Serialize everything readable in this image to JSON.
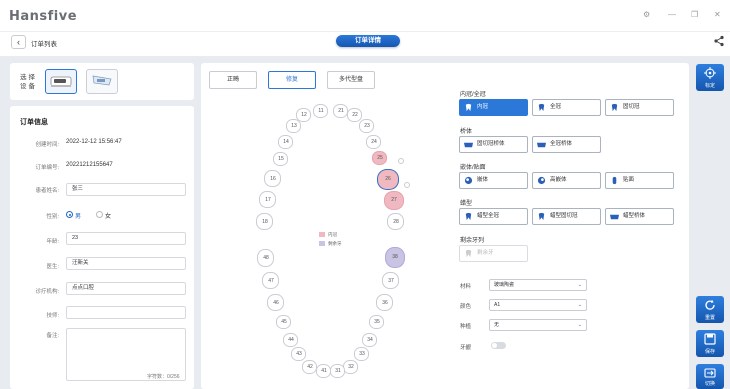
{
  "app": {
    "logo": "Hansfive"
  },
  "window": {
    "icons": [
      "settings-icon",
      "minimize-icon",
      "restore-icon",
      "close-icon"
    ]
  },
  "nav": {
    "back_label": "订单列表",
    "page_title": "订单详情"
  },
  "device": {
    "label": "选择设备"
  },
  "order": {
    "title": "订单信息",
    "created_label": "创建时间:",
    "created_value": "2022-12-12 15:56:47",
    "number_label": "订单编号:",
    "number_value": "20221212155647",
    "patient_label": "患者姓名:",
    "patient_value": "张三",
    "gender_label": "性别:",
    "male": "男",
    "female": "女",
    "age_label": "年龄:",
    "age_value": "23",
    "doctor_label": "医生:",
    "doctor_value": "汪新关",
    "clinic_label": "诊疗机构:",
    "clinic_value": "点点口腔",
    "tech_label": "技师:",
    "tech_value": "",
    "note_label": "备注:",
    "note_counter": "字符数：0/256"
  },
  "modes": {
    "normal": "正畸",
    "repair": "修复",
    "multi": "多代型盘"
  },
  "teeth": [
    {
      "n": "11"
    },
    {
      "n": "21"
    },
    {
      "n": "12"
    },
    {
      "n": "22"
    },
    {
      "n": "13"
    },
    {
      "n": "23"
    },
    {
      "n": "14"
    },
    {
      "n": "24"
    },
    {
      "n": "15"
    },
    {
      "n": "25"
    },
    {
      "n": "16"
    },
    {
      "n": "26"
    },
    {
      "n": "17"
    },
    {
      "n": "27"
    },
    {
      "n": "18"
    },
    {
      "n": "28"
    },
    {
      "n": "48"
    },
    {
      "n": "38"
    },
    {
      "n": "47"
    },
    {
      "n": "37"
    },
    {
      "n": "46"
    },
    {
      "n": "36"
    },
    {
      "n": "45"
    },
    {
      "n": "35"
    },
    {
      "n": "44"
    },
    {
      "n": "34"
    },
    {
      "n": "43"
    },
    {
      "n": "33"
    },
    {
      "n": "42"
    },
    {
      "n": "32"
    },
    {
      "n": "41"
    },
    {
      "n": "31"
    }
  ],
  "legend": {
    "crown": "内冠",
    "other": "剩余牙"
  },
  "colors": {
    "accent": "#2b78d8",
    "crown": "#f0b8c0",
    "remain": "#c9c3e4"
  },
  "restoration": {
    "crown_title": "内冠/全冠",
    "crown_items": [
      "内冠",
      "全冠",
      "固切冠"
    ],
    "bridge_title": "桥体",
    "bridge_items": [
      "固切冠桥体",
      "全冠桥体"
    ],
    "veneer_title": "嵌体/贴面",
    "veneer_items": [
      "嵌体",
      "高嵌体",
      "贴面"
    ],
    "wax_title": "蜡型",
    "wax_items": [
      "蜡型全冠",
      "蜡型固切冠",
      "蜡型桥体"
    ],
    "remain_title": "剩余牙列",
    "remain_items": [
      "剩余牙"
    ]
  },
  "props": {
    "material_label": "材料",
    "material_value": "玻璃陶瓷",
    "color_label": "颜色",
    "color_value": "A1",
    "implant_label": "种植",
    "implant_value": "无",
    "gum_label": "牙龈"
  },
  "side": {
    "calibrate": "标定",
    "reset": "重置",
    "save": "保存",
    "switch": "切换"
  }
}
